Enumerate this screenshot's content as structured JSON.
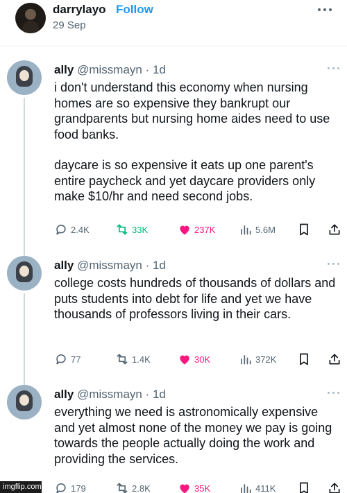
{
  "post": {
    "author": "darrylayo",
    "follow_label": "Follow",
    "date": "29 Sep"
  },
  "tweets": [
    {
      "name": "ally",
      "handle": "@missmayn",
      "time": "· 1d",
      "paragraphs": [
        "i don't understand this economy when nursing homes are so expensive they bankrupt our grandparents but nursing home aides need to use food banks.",
        "daycare is so expensive it eats up one parent's entire paycheck and yet daycare providers only make $10/hr and need second jobs."
      ],
      "replies": "2.4K",
      "retweets": "33K",
      "likes": "237K",
      "views": "5.6M"
    },
    {
      "name": "ally",
      "handle": "@missmayn",
      "time": "· 1d",
      "paragraphs": [
        "college costs hundreds of thousands of dollars and puts students into debt for life and yet we have thousands of professors living in their cars."
      ],
      "replies": "77",
      "retweets": "1.4K",
      "likes": "30K",
      "views": "372K"
    },
    {
      "name": "ally",
      "handle": "@missmayn",
      "time": "· 1d",
      "paragraphs": [
        "everything we need is astronomically expensive and yet almost none of the money we pay is going towards the people actually doing the work and providing the services."
      ],
      "replies": "179",
      "retweets": "2.8K",
      "likes": "35K",
      "views": "411K"
    }
  ],
  "watermark": "imgflip.com",
  "colors": {
    "retweet": "#00ba7c",
    "like": "#f91880",
    "follow": "#1d9bf0",
    "muted": "#536471"
  }
}
